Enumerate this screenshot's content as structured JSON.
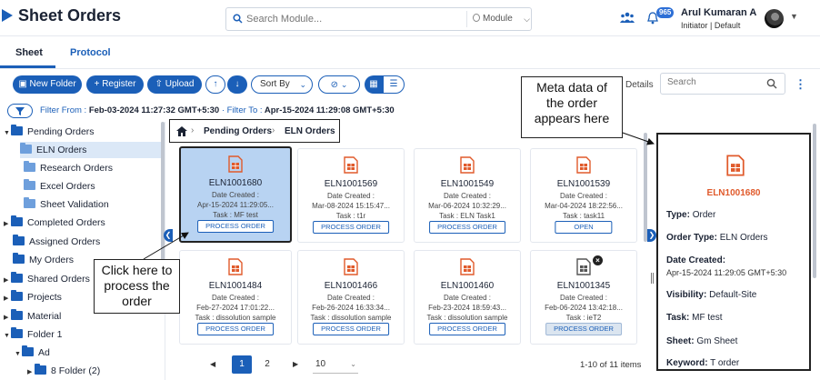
{
  "app": {
    "title": "Sheet Orders",
    "search_placeholder": "Search Module...",
    "module_label": "Module",
    "notification_count": "965",
    "user_name": "Arul Kumaran A",
    "user_role": "Initiator | Default"
  },
  "tabs": [
    {
      "label": "Sheet"
    },
    {
      "label": "Protocol"
    }
  ],
  "toolbar": {
    "new_folder": "New Folder",
    "register": "Register",
    "upload": "Upload",
    "sort_by": "Sort By",
    "details": "Details",
    "search_placeholder": "Search"
  },
  "filter": {
    "from_label": "Filter From :",
    "from_value": "Feb-03-2024 11:27:32 GMT+5:30",
    "to_label": "· Filter To :",
    "to_value": "Apr-15-2024 11:29:08 GMT+5:30"
  },
  "tree": [
    {
      "label": "Pending Orders"
    },
    {
      "label": "ELN Orders"
    },
    {
      "label": "Research Orders"
    },
    {
      "label": "Excel Orders"
    },
    {
      "label": "Sheet Validation"
    },
    {
      "label": "Completed Orders"
    },
    {
      "label": "Assigned Orders"
    },
    {
      "label": "My Orders"
    },
    {
      "label": "Shared Orders"
    },
    {
      "label": "Projects"
    },
    {
      "label": "Material"
    },
    {
      "label": "Folder 1"
    },
    {
      "label": "Ad"
    },
    {
      "label": "8 Folder (2)"
    }
  ],
  "breadcrumb": [
    "Pending Orders",
    "ELN Orders"
  ],
  "cards": [
    {
      "id": "ELN1001680",
      "created_label": "Date Created :",
      "created": "Apr-15-2024 11:29:05...",
      "task": "Task : MF test",
      "action": "PROCESS ORDER"
    },
    {
      "id": "ELN1001569",
      "created_label": "Date Created :",
      "created": "Mar-08-2024 15:15:47...",
      "task": "Task : t1r",
      "action": "PROCESS ORDER"
    },
    {
      "id": "ELN1001549",
      "created_label": "Date Created :",
      "created": "Mar-06-2024 10:32:29...",
      "task": "Task : ELN Task1",
      "action": "PROCESS ORDER"
    },
    {
      "id": "ELN1001539",
      "created_label": "Date Created :",
      "created": "Mar-04-2024 18:22:56...",
      "task": "Task : task11",
      "action": "OPEN"
    },
    {
      "id": "ELN1001484",
      "created_label": "Date Created :",
      "created": "Feb-27-2024 17:01:22...",
      "task": "Task : dissolution sample",
      "action": "PROCESS ORDER"
    },
    {
      "id": "ELN1001466",
      "created_label": "Date Created :",
      "created": "Feb-26-2024 16:33:34...",
      "task": "Task : dissolution sample",
      "action": "PROCESS ORDER"
    },
    {
      "id": "ELN1001460",
      "created_label": "Date Created :",
      "created": "Feb-23-2024 18:59:43...",
      "task": "Task : dissolution sample",
      "action": "PROCESS ORDER"
    },
    {
      "id": "ELN1001345",
      "created_label": "Date Created :",
      "created": "Feb-06-2024 13:42:18...",
      "task": "Task : ieT2",
      "action": "PROCESS ORDER"
    }
  ],
  "pagination": {
    "pages": [
      "1",
      "2"
    ],
    "page_size": "10",
    "info": "1-10 of 11 items"
  },
  "meta": {
    "id": "ELN1001680",
    "type_label": "Type:",
    "type_value": "Order",
    "order_type_label": "Order Type:",
    "order_type_value": "ELN Orders",
    "date_label": "Date Created:",
    "date_value": "Apr-15-2024 11:29:05 GMT+5:30",
    "visibility_label": "Visibility:",
    "visibility_value": "Default-Site",
    "task_label": "Task:",
    "task_value": "MF test",
    "sheet_label": "Sheet:",
    "sheet_value": "Gm Sheet",
    "keyword_label": "Keyword:",
    "keyword_value": "T order"
  },
  "callouts": {
    "meta": [
      "Meta data of",
      "the order",
      "appears here"
    ],
    "click": [
      "Click here to",
      "process the",
      "order"
    ]
  },
  "colors": {
    "accent": "#1b5fb8",
    "order_icon": "#e05a2b",
    "selected_card": "#b8d3f2"
  }
}
